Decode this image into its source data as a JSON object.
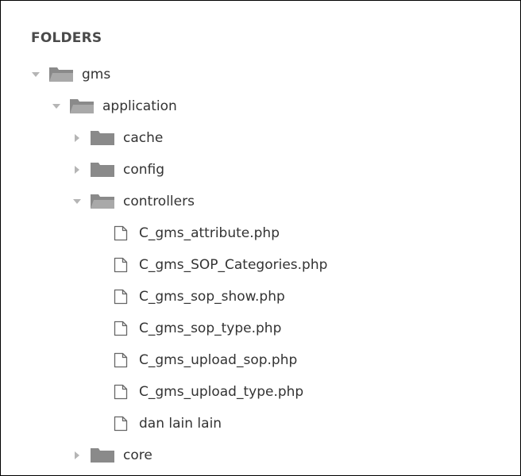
{
  "sidebar": {
    "header": "FOLDERS",
    "tree": [
      {
        "label": "gms",
        "type": "folder",
        "expanded": true,
        "depth": 0
      },
      {
        "label": "application",
        "type": "folder",
        "expanded": true,
        "depth": 1
      },
      {
        "label": "cache",
        "type": "folder",
        "expanded": false,
        "depth": 2
      },
      {
        "label": "config",
        "type": "folder",
        "expanded": false,
        "depth": 2
      },
      {
        "label": "controllers",
        "type": "folder",
        "expanded": true,
        "depth": 2
      },
      {
        "label": "C_gms_attribute.php",
        "type": "file",
        "depth": 3
      },
      {
        "label": "C_gms_SOP_Categories.php",
        "type": "file",
        "depth": 3
      },
      {
        "label": "C_gms_sop_show.php",
        "type": "file",
        "depth": 3
      },
      {
        "label": "C_gms_sop_type.php",
        "type": "file",
        "depth": 3
      },
      {
        "label": "C_gms_upload_sop.php",
        "type": "file",
        "depth": 3
      },
      {
        "label": "C_gms_upload_type.php",
        "type": "file",
        "depth": 3
      },
      {
        "label": "dan lain lain",
        "type": "file",
        "depth": 3
      },
      {
        "label": "core",
        "type": "folder",
        "expanded": false,
        "depth": 2
      }
    ]
  },
  "colors": {
    "folder_fill": "#8a8a8a",
    "arrow": "#b5b5b5",
    "text": "#333333",
    "header": "#4a4a4a"
  }
}
